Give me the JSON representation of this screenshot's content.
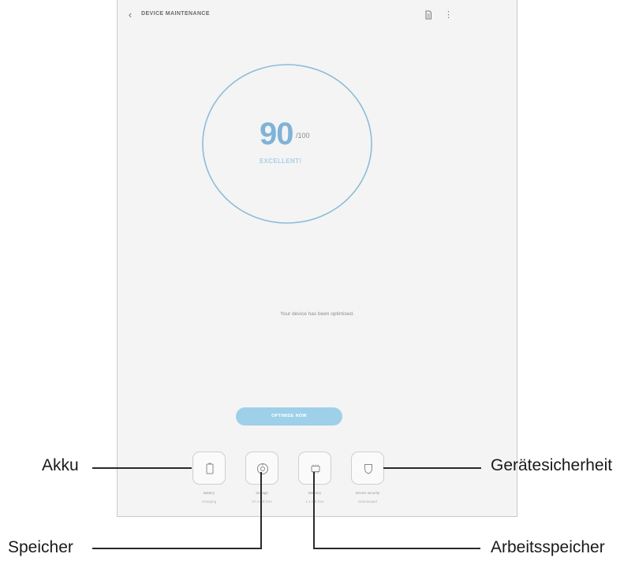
{
  "app": {
    "title": "DEVICE MAINTENANCE",
    "back_icon": "back-arrow-icon",
    "report_icon": "document-icon",
    "more_icon": "more-vertical-icon"
  },
  "score": {
    "value": "90",
    "max": "/100",
    "status": "EXCELLENT!",
    "ring_color": "#8cbcd9"
  },
  "message": "Your device has been optimised.",
  "optimise_button": "OPTIMISE NOW",
  "tiles": [
    {
      "label": "Battery",
      "sub": "Charging",
      "icon": "battery-icon"
    },
    {
      "label": "Storage",
      "sub": "37.4 GB free",
      "icon": "storage-icon"
    },
    {
      "label": "Memory",
      "sub": "1.1 GB free",
      "icon": "memory-chip-icon"
    },
    {
      "label": "Device security",
      "sub": "Deactivated",
      "icon": "shield-icon"
    }
  ],
  "callouts": {
    "battery": "Akku",
    "storage": "Speicher",
    "memory": "Arbeitsspeicher",
    "security": "Gerätesicherheit"
  },
  "colors": {
    "accent": "#9ed0ea",
    "score_text": "#7fb3d7",
    "screen_bg": "#f4f4f4"
  }
}
